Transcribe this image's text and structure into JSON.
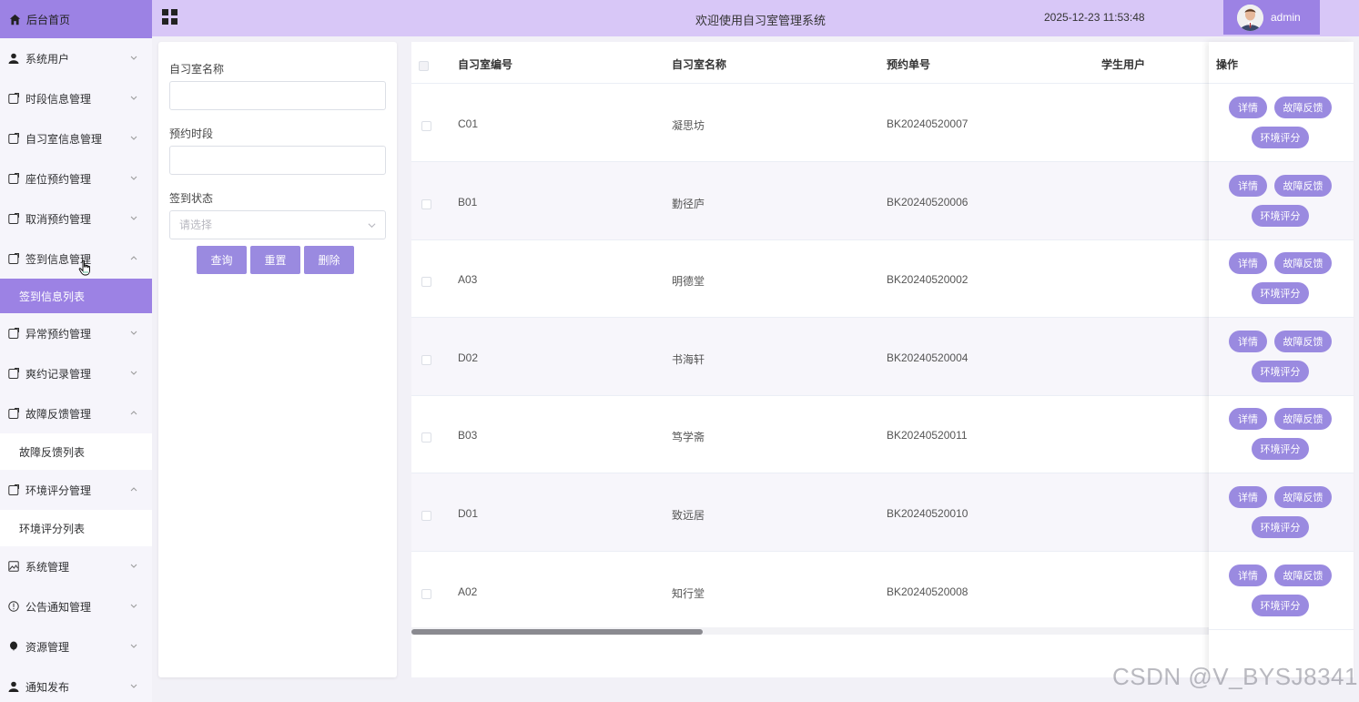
{
  "sidebar": {
    "home": "后台首页",
    "items": [
      {
        "label": "系统用户",
        "icon": "user-icon"
      },
      {
        "label": "时段信息管理",
        "icon": "doc-icon"
      },
      {
        "label": "自习室信息管理",
        "icon": "doc-icon"
      },
      {
        "label": "座位预约管理",
        "icon": "doc-icon"
      },
      {
        "label": "取消预约管理",
        "icon": "doc-icon"
      },
      {
        "label": "签到信息管理",
        "icon": "doc-icon",
        "expanded": true
      },
      {
        "label": "异常预约管理",
        "icon": "doc-icon"
      },
      {
        "label": "爽约记录管理",
        "icon": "doc-icon"
      },
      {
        "label": "故障反馈管理",
        "icon": "doc-icon",
        "expanded": true
      },
      {
        "label": "环境评分管理",
        "icon": "doc-icon",
        "expanded": true
      },
      {
        "label": "系统管理",
        "icon": "image-icon"
      },
      {
        "label": "公告通知管理",
        "icon": "info-icon"
      },
      {
        "label": "资源管理",
        "icon": "balloon-icon"
      },
      {
        "label": "通知发布",
        "icon": "user-icon"
      }
    ],
    "subs": {
      "checkin_list": "签到信息列表",
      "fault_list": "故障反馈列表",
      "env_list": "环境评分列表"
    }
  },
  "header": {
    "title": "欢迎使用自习室管理系统",
    "datetime": "2025-12-23 11:53:48",
    "user": "admin"
  },
  "search": {
    "room_name_label": "自习室名称",
    "slot_label": "预约时段",
    "status_label": "签到状态",
    "status_placeholder": "请选择",
    "query_btn": "查询",
    "reset_btn": "重置",
    "delete_btn": "删除"
  },
  "table": {
    "headers": [
      "自习室编号",
      "自习室名称",
      "预约单号",
      "学生用户",
      "操作"
    ],
    "rows": [
      {
        "code": "C01",
        "name": "凝思坊",
        "order": "BK20240520007"
      },
      {
        "code": "B01",
        "name": "勤径庐",
        "order": "BK20240520006"
      },
      {
        "code": "A03",
        "name": "明德堂",
        "order": "BK20240520002"
      },
      {
        "code": "D02",
        "name": "书海轩",
        "order": "BK20240520004"
      },
      {
        "code": "B03",
        "name": "笃学斋",
        "order": "BK20240520011"
      },
      {
        "code": "D01",
        "name": "致远居",
        "order": "BK20240520010"
      },
      {
        "code": "A02",
        "name": "知行堂",
        "order": "BK20240520008"
      }
    ],
    "actions": {
      "detail": "详情",
      "fault": "故障反馈",
      "env": "环境评分"
    }
  },
  "watermark": "CSDN @V_BYSJ8341",
  "colors": {
    "accent": "#9c82e4",
    "header": "#d8c7f7",
    "button": "#9a8ae0"
  }
}
